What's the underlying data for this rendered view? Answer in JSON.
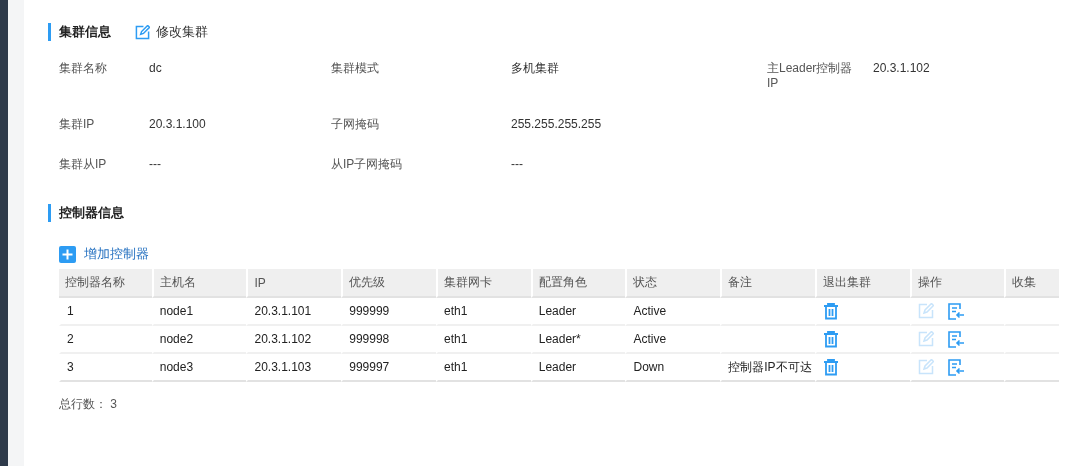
{
  "cluster": {
    "title": "集群信息",
    "edit_link": "修改集群",
    "fields": [
      {
        "label": "集群名称",
        "value": "dc"
      },
      {
        "label": "集群模式",
        "value": "多机集群"
      },
      {
        "label": "主Leader控制器IP",
        "value": "20.3.1.102"
      },
      {
        "label": "集群IP",
        "value": "20.3.1.100"
      },
      {
        "label": "子网掩码",
        "value": "255.255.255.255"
      },
      {
        "label": "集群从IP",
        "value": "---"
      },
      {
        "label": "从IP子网掩码",
        "value": "---"
      }
    ]
  },
  "controllers": {
    "title": "控制器信息",
    "add_button": "增加控制器",
    "columns": [
      "控制器名称",
      "主机名",
      "IP",
      "优先级",
      "集群网卡",
      "配置角色",
      "状态",
      "备注",
      "退出集群",
      "操作",
      "收集"
    ],
    "rows": [
      {
        "cells": [
          "1",
          "node1",
          "20.3.1.101",
          "999999",
          "eth1",
          "Leader",
          "Active",
          ""
        ],
        "edit_disabled": true
      },
      {
        "cells": [
          "2",
          "node2",
          "20.3.1.102",
          "999998",
          "eth1",
          "Leader*",
          "Active",
          ""
        ],
        "edit_disabled": true
      },
      {
        "cells": [
          "3",
          "node3",
          "20.3.1.103",
          "999997",
          "eth1",
          "Leader",
          "Down",
          "控制器IP不可达"
        ],
        "edit_disabled": true
      }
    ],
    "total": "总行数： 3"
  }
}
